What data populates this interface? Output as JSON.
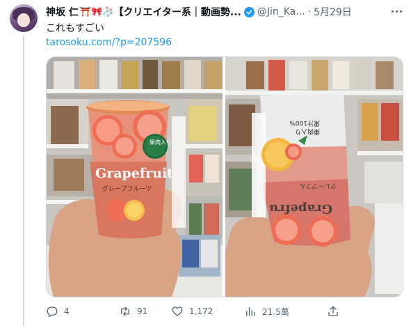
{
  "author": {
    "display_name": "神坂 仁",
    "emoji": "⛩️🎀🧦",
    "name_suffix": "【クリエイター系｜動画勢...",
    "handle": "@Jin_Ka...",
    "separator": "·",
    "date": "5月29日"
  },
  "tweet": {
    "text": "これもすごい",
    "link": "tarosoku.com/?p=207596"
  },
  "photos": {
    "left": {
      "cup_label_main": "Grapefruit",
      "cup_label_sub": "グレープフルーツ",
      "badge": "果肉入り"
    },
    "right": {
      "cup_label_main": "Grapefru",
      "cup_label_sub": "グレープフル",
      "badge_text": "果汁100%",
      "badge_text2": "果肉入り"
    }
  },
  "actions": {
    "replies": "4",
    "retweets": "91",
    "likes": "1,172",
    "views": "21.5萬"
  },
  "colors": {
    "link": "#1d9bf0",
    "verified": "#1d9bf0",
    "secondary_text": "#536471"
  },
  "icons": [
    "reply-icon",
    "retweet-icon",
    "like-icon",
    "views-icon",
    "share-icon",
    "verified-badge-icon",
    "more-icon"
  ]
}
